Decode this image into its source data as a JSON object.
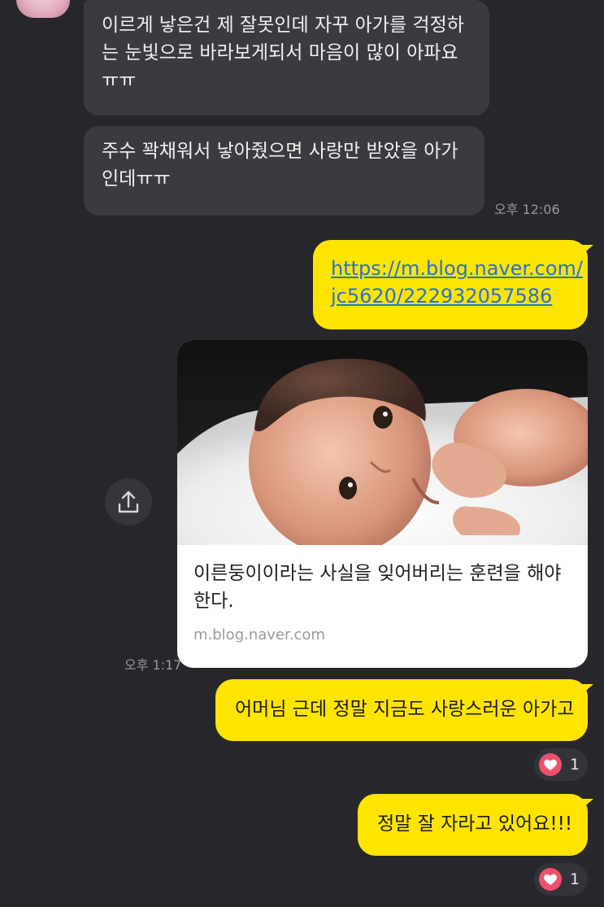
{
  "messages_in": [
    {
      "text": "이르게 낳은건 제 잘못인데 자꾸 아가를 걱정하는 눈빛으로 바라보게되서 마음이 많이 아파요ㅠㅠ"
    },
    {
      "text": "주수 꽉채워서 낳아줬으면 사랑만 받았을 아가인데ㅠㅠ"
    }
  ],
  "time_1": "오후 12:06",
  "link_message": {
    "line1": "https://m.blog.naver.com/",
    "line2": "jc5620/222932057586"
  },
  "link_card": {
    "title": "이른둥이이라는 사실을 잊어버리는 훈련을 해야 한다.",
    "domain": "m.blog.naver.com"
  },
  "time_2": "오후 1:17",
  "messages_out": [
    {
      "text": "어머님 근데 정말 지금도 사랑스러운 아가고",
      "reaction_count": "1"
    },
    {
      "text": "정말 잘 자라고 있어요!!!",
      "reaction_count": "1"
    }
  ],
  "colors": {
    "background": "#27272b",
    "incoming_bubble": "#3a3a3f",
    "outgoing_bubble": "#fee500",
    "link": "#2a6fd6",
    "heart": "#f0506e"
  },
  "icons": {
    "share": "share-icon",
    "reaction": "heart-icon"
  }
}
